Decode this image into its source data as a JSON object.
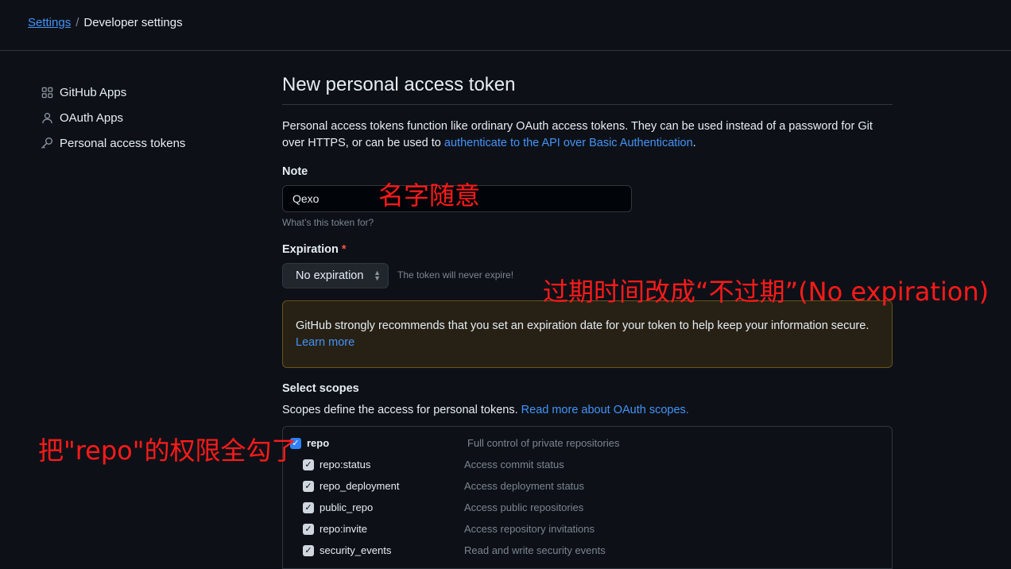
{
  "breadcrumb": {
    "root": "Settings",
    "separator": "/",
    "current": "Developer settings"
  },
  "sidebar": {
    "items": [
      {
        "label": "GitHub Apps",
        "icon": "apps-grid-icon"
      },
      {
        "label": "OAuth Apps",
        "icon": "person-icon"
      },
      {
        "label": "Personal access tokens",
        "icon": "key-icon"
      }
    ]
  },
  "main": {
    "title": "New personal access token",
    "intro_prefix": "Personal access tokens function like ordinary OAuth access tokens. They can be used instead of a password for Git over HTTPS, or can be used to ",
    "intro_link": "authenticate to the API over Basic Authentication",
    "intro_suffix": "."
  },
  "note": {
    "label": "Note",
    "value": "Qexo",
    "hint": "What’s this token for?"
  },
  "expiration": {
    "label": "Expiration",
    "required_mark": "*",
    "selected": "No expiration",
    "note": "The token will never expire!"
  },
  "warning": {
    "text": "GitHub strongly recommends that you set an expiration date for your token to help keep your information secure.",
    "link": "Learn more"
  },
  "scopes": {
    "label": "Select scopes",
    "desc_prefix": "Scopes define the access for personal tokens. ",
    "desc_link": "Read more about OAuth scopes.",
    "items": [
      {
        "name": "repo",
        "desc": "Full control of private repositories",
        "checked": true
      },
      {
        "name": "repo:status",
        "desc": "Access commit status",
        "checked": true
      },
      {
        "name": "repo_deployment",
        "desc": "Access deployment status",
        "checked": true
      },
      {
        "name": "public_repo",
        "desc": "Access public repositories",
        "checked": true
      },
      {
        "name": "repo:invite",
        "desc": "Access repository invitations",
        "checked": true
      },
      {
        "name": "security_events",
        "desc": "Read and write security events",
        "checked": true
      }
    ]
  },
  "annotations": {
    "note": "名字随意",
    "expiration": "过期时间改成“不过期”(No expiration)",
    "repo": "把\"repo\"的权限全勾了",
    "color": "#ff1a1a"
  }
}
